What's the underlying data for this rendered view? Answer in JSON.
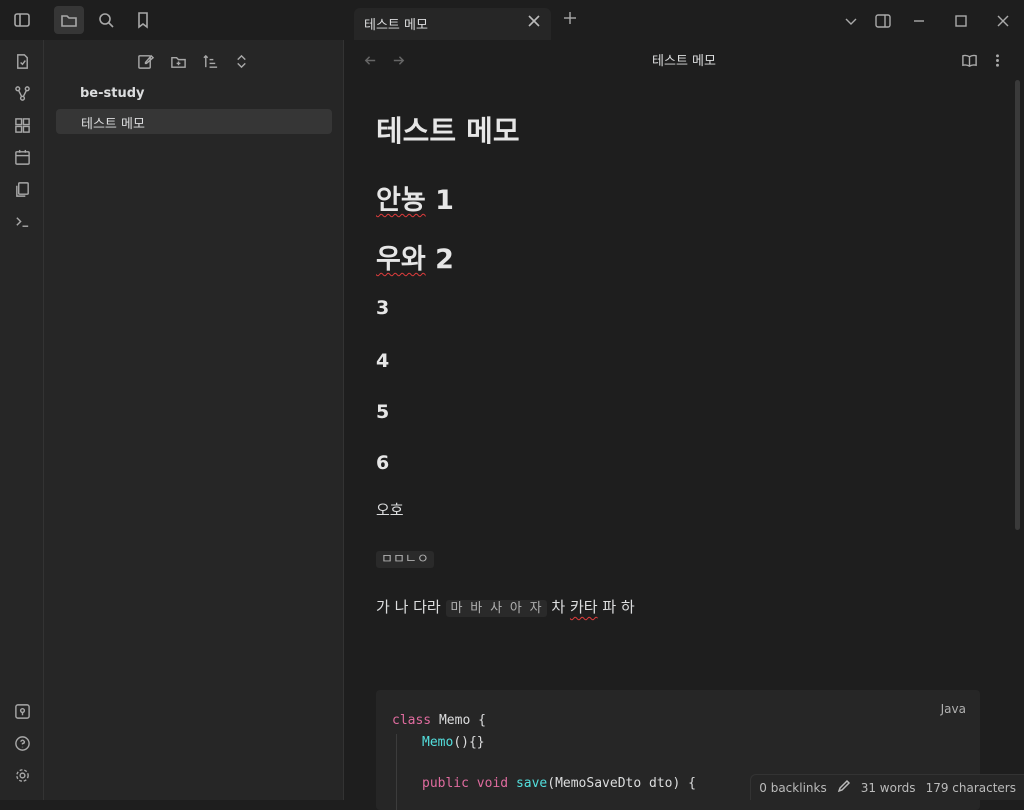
{
  "titlebar": {
    "tab_title": "테스트 메모"
  },
  "sidebar": {
    "folder_name": "be-study",
    "file_name": "테스트 메모"
  },
  "view": {
    "title": "테스트 메모"
  },
  "document": {
    "title": "테스트 메모",
    "h2_1_word": "안뇽",
    "h2_1_num": " 1",
    "h2_2_word": "우와",
    "h2_2_num": " 2",
    "h3_1": "3",
    "h3_2": "4",
    "h3_3": "5",
    "h3_4": "6",
    "para_1": "오호",
    "code_1": "ㅁㅁㄴㅇ",
    "para_2_a": "가 나 다라 ",
    "para_2_code": "마 바 사 아 자",
    "para_2_b": " 차 ",
    "para_2_miss": "카타",
    "para_2_c": " 파 하"
  },
  "codeblock": {
    "language": "Java",
    "line1_kw": "class",
    "line1_rest": " Memo {",
    "line2_fn": "Memo",
    "line2_rest": "(){}",
    "line3_kw1": "public",
    "line3_kw2": "void",
    "line3_fn": "save",
    "line3_rest": "(MemoSaveDto dto) {"
  },
  "status": {
    "backlinks": "0 backlinks",
    "words": "31 words",
    "characters": "179 characters"
  },
  "icons": {
    "ribbon": [
      "files-icon",
      "graph-icon",
      "canvas-icon",
      "daily-note-icon",
      "templates-icon",
      "terminal-icon",
      "vault-icon",
      "help-icon",
      "settings-icon"
    ]
  }
}
